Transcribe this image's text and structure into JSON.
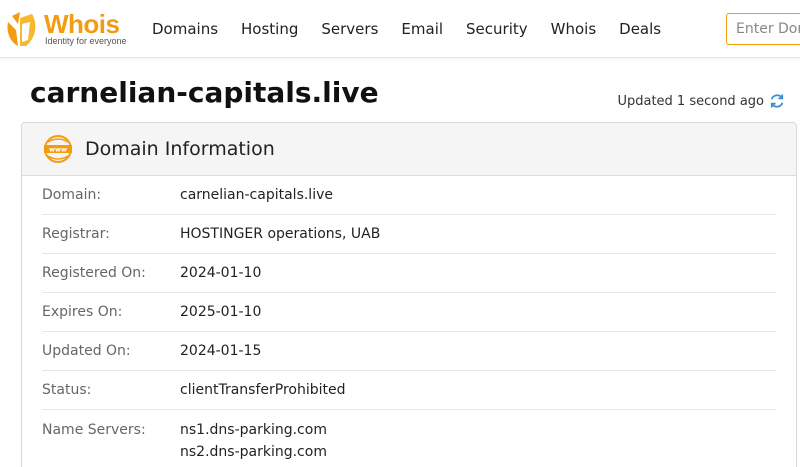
{
  "brand": {
    "name": "Whois",
    "tagline": "Identity for everyone",
    "accent": "#f39c12"
  },
  "nav": {
    "items": [
      "Domains",
      "Hosting",
      "Servers",
      "Email",
      "Security",
      "Whois",
      "Deals"
    ]
  },
  "search": {
    "placeholder": "Enter Domain or IP"
  },
  "page": {
    "title": "carnelian-capitals.live",
    "updated": "Updated 1 second ago"
  },
  "domain_info": {
    "heading": "Domain Information",
    "icon": "www-icon",
    "rows": [
      {
        "label": "Domain:",
        "value": "carnelian-capitals.live"
      },
      {
        "label": "Registrar:",
        "value": "HOSTINGER operations, UAB"
      },
      {
        "label": "Registered On:",
        "value": "2024-01-10"
      },
      {
        "label": "Expires On:",
        "value": "2025-01-10"
      },
      {
        "label": "Updated On:",
        "value": "2024-01-15"
      },
      {
        "label": "Status:",
        "value": "clientTransferProhibited"
      }
    ],
    "name_servers": {
      "label": "Name Servers:",
      "values": [
        "ns1.dns-parking.com",
        "ns2.dns-parking.com"
      ]
    }
  }
}
